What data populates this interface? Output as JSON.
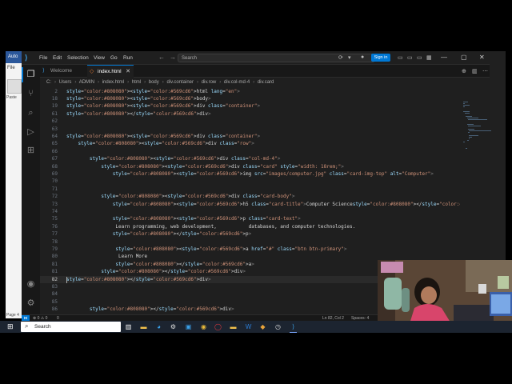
{
  "background_app": {
    "title_fragment": "Auto",
    "tab_fragment": "File",
    "paste_label": "Paste",
    "page_indicator": "Page 4"
  },
  "window": {
    "menu": [
      "File",
      "Edit",
      "Selection",
      "View",
      "Go",
      "Run"
    ],
    "search_placeholder": "Search",
    "signin_label": "Sign in",
    "controls": {
      "minimize": "—",
      "maximize": "▢",
      "close": "✕"
    }
  },
  "tabs": [
    {
      "label": "Welcome",
      "icon": "vscode-icon"
    },
    {
      "label": "index.html",
      "icon": "html-file-icon"
    }
  ],
  "breadcrumb": [
    "C:",
    "Users",
    "ADMIN",
    "index.html",
    "html",
    "body",
    "div.container",
    "div.row",
    "div.col-md-4",
    "div.card"
  ],
  "editor": {
    "lines": [
      {
        "n": "2",
        "code": "<html lang=\"en\">"
      },
      {
        "n": "18",
        "code": "<body>"
      },
      {
        "n": "19",
        "code": "<div class=\"container\">"
      },
      {
        "n": "61",
        "code": "</div>"
      },
      {
        "n": "62",
        "code": ""
      },
      {
        "n": "63",
        "code": ""
      },
      {
        "n": "64",
        "code": "<div class=\"container\">"
      },
      {
        "n": "65",
        "code": "    <div class=\"row\">"
      },
      {
        "n": "66",
        "code": ""
      },
      {
        "n": "67",
        "code": "        <div class=\"col-md-4\">"
      },
      {
        "n": "68",
        "code": "            <div class=\"card\" style=\"width: 18rem;\">"
      },
      {
        "n": "69",
        "code": "                <img src=\"images/computer.jpg\" class=\"card-img-top\" alt=\"Computer\">"
      },
      {
        "n": "70",
        "code": ""
      },
      {
        "n": "71",
        "code": ""
      },
      {
        "n": "72",
        "code": "            <div class=\"card-body\">"
      },
      {
        "n": "73",
        "code": "                <h5 class=\"card-title\">Computer Science</h5>"
      },
      {
        "n": "74",
        "code": ""
      },
      {
        "n": "75",
        "code": "                <p class=\"card-text\">"
      },
      {
        "n": "76",
        "code": "                 Learn programming, web development,           databases, and computer technologies."
      },
      {
        "n": "77",
        "code": "                </p>"
      },
      {
        "n": "78",
        "code": ""
      },
      {
        "n": "79",
        "code": "                 <a href=\"#\" class=\"btn btn-primary\">"
      },
      {
        "n": "80",
        "code": "                  Learn More"
      },
      {
        "n": "81",
        "code": "                 </a>"
      },
      {
        "n": "81",
        "code": "            </div>"
      },
      {
        "n": "82",
        "code": "</div>"
      },
      {
        "n": "83",
        "code": ""
      },
      {
        "n": "84",
        "code": ""
      },
      {
        "n": "85",
        "code": ""
      },
      {
        "n": "86",
        "code": "        </div>"
      },
      {
        "n": "87",
        "code": ""
      }
    ],
    "current_line_index": 25
  },
  "statusbar": {
    "problems": "⊗ 0 ⚠ 0",
    "ports": "0",
    "position": "Ln 82, Col 2",
    "spaces": "Spaces: 4"
  },
  "taskbar": {
    "search_placeholder": "Search",
    "apps": [
      "task-view-icon",
      "file-explorer-icon",
      "edge-icon",
      "settings-icon",
      "store-icon",
      "chrome-icon",
      "opera-icon",
      "folder-icon",
      "word-icon",
      "photos-icon",
      "app-icon",
      "clock-icon",
      "vscode-icon"
    ]
  },
  "colors": {
    "accent": "#0078d4",
    "editor_bg": "#1f1f1f",
    "tag": "#569cd6",
    "attr": "#9cdcfe",
    "string": "#ce9178"
  }
}
